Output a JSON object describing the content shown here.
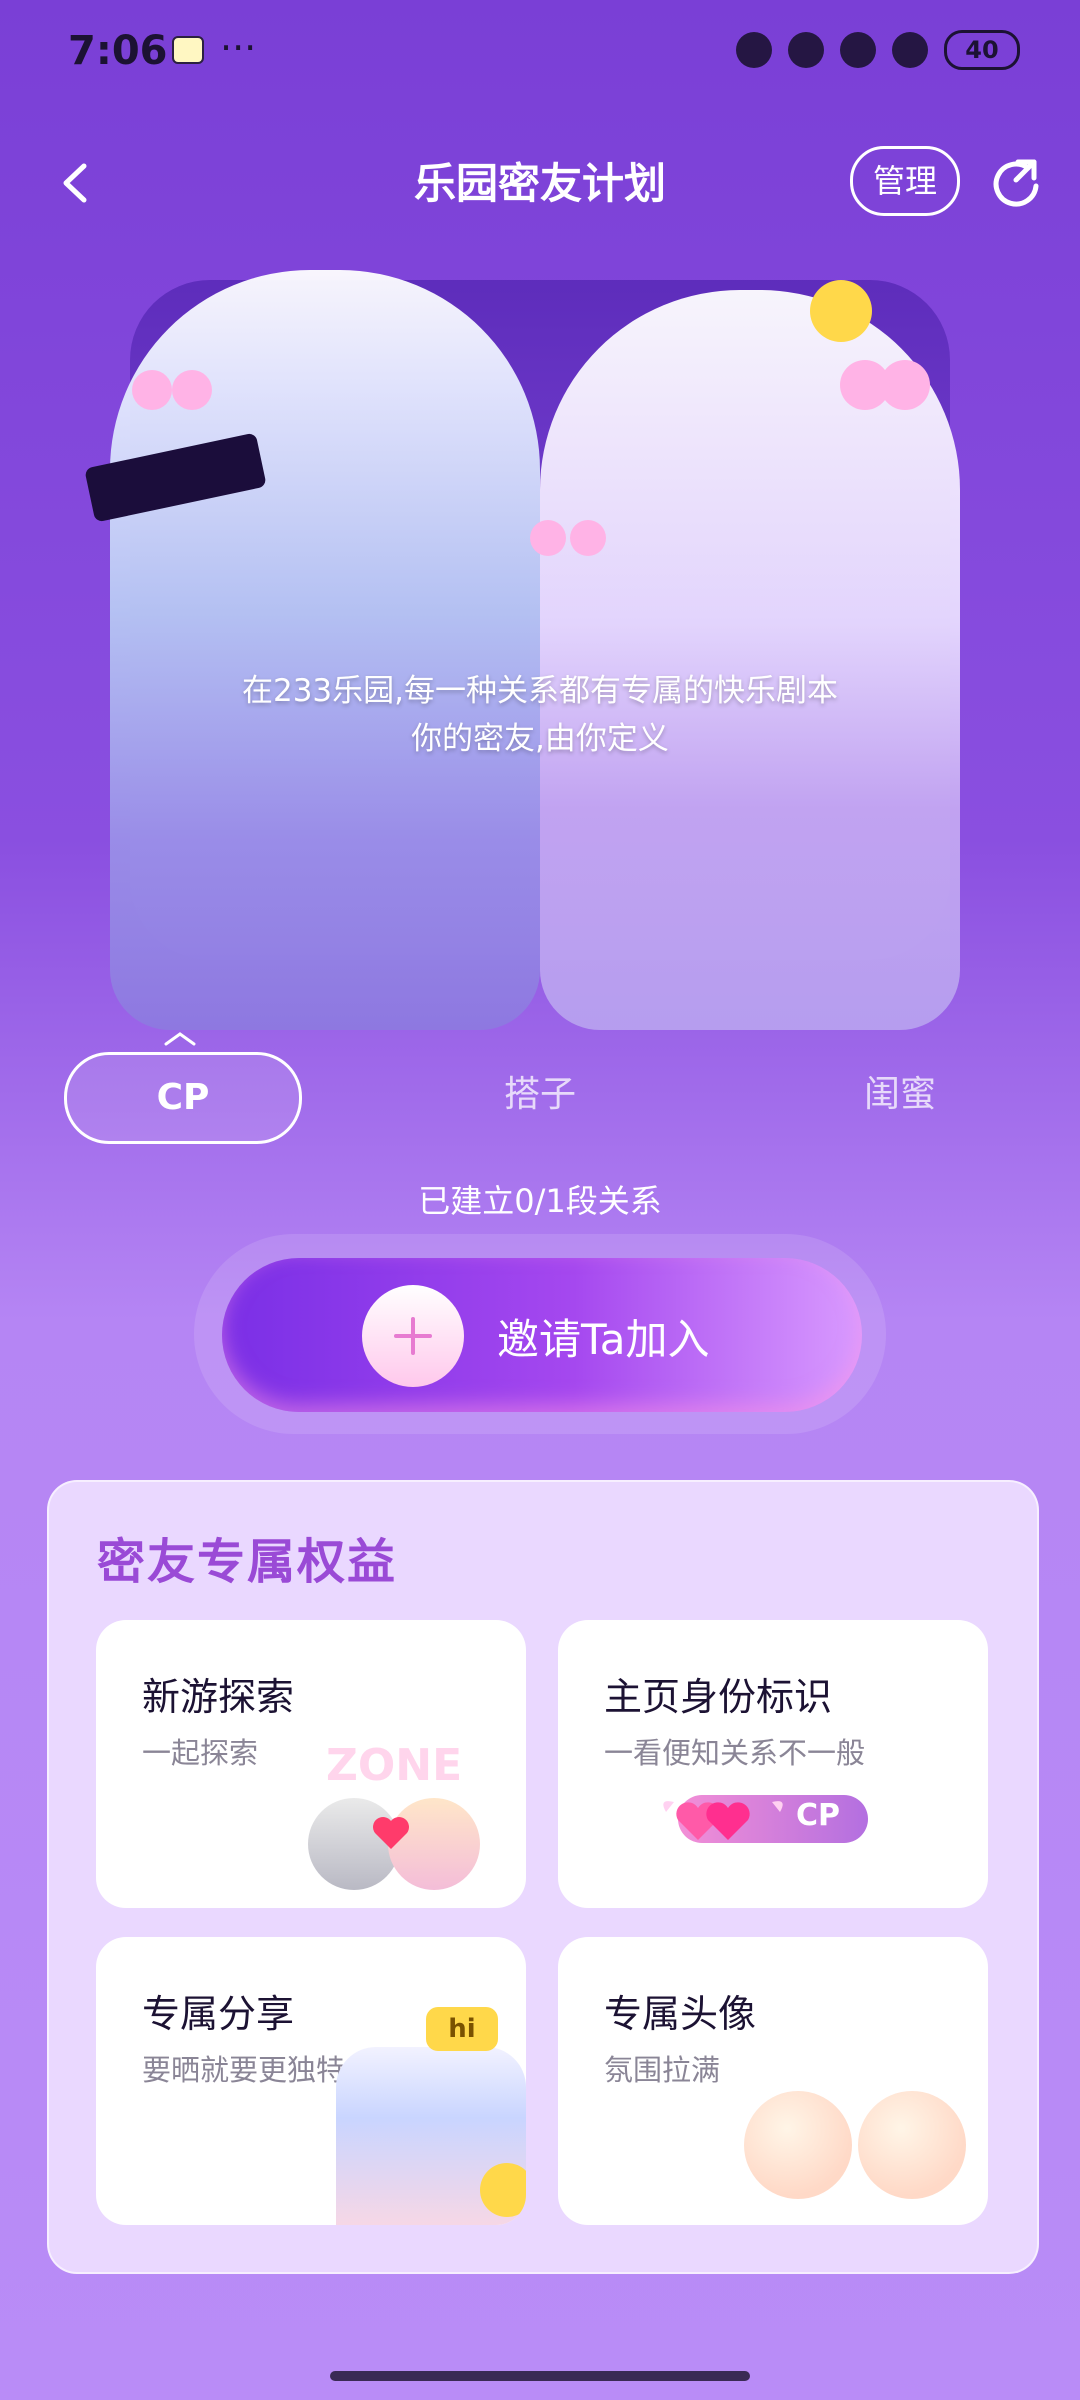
{
  "status_bar": {
    "time": "7:06",
    "more": "···",
    "battery": "40"
  },
  "header": {
    "title": "乐园密友计划",
    "manage_label": "管理"
  },
  "hero": {
    "slogan_line1": "在233乐园,每一种关系都有专属的快乐剧本",
    "slogan_line2": "你的密友,由你定义"
  },
  "tabs": [
    {
      "label": "CP",
      "active": true
    },
    {
      "label": "搭子",
      "active": false
    },
    {
      "label": "闺蜜",
      "active": false
    }
  ],
  "relation_count": "已建立0/1段关系",
  "invite": {
    "label": "邀请Ta加入"
  },
  "benefits": {
    "title": "密友专属权益",
    "items": [
      {
        "title": "新游探索",
        "subtitle": "一起探索",
        "badge": "ZONE"
      },
      {
        "title": "主页身份标识",
        "subtitle": "一看便知关系不一般",
        "badge": "CP"
      },
      {
        "title": "专属分享",
        "subtitle": "要晒就要更独特",
        "badge": "hi"
      },
      {
        "title": "专属头像",
        "subtitle": "氛围拉满"
      }
    ]
  },
  "colors": {
    "accent": "#8a4fe0",
    "panel": "#ead8ff",
    "title_purple": "#9a4ad6"
  }
}
